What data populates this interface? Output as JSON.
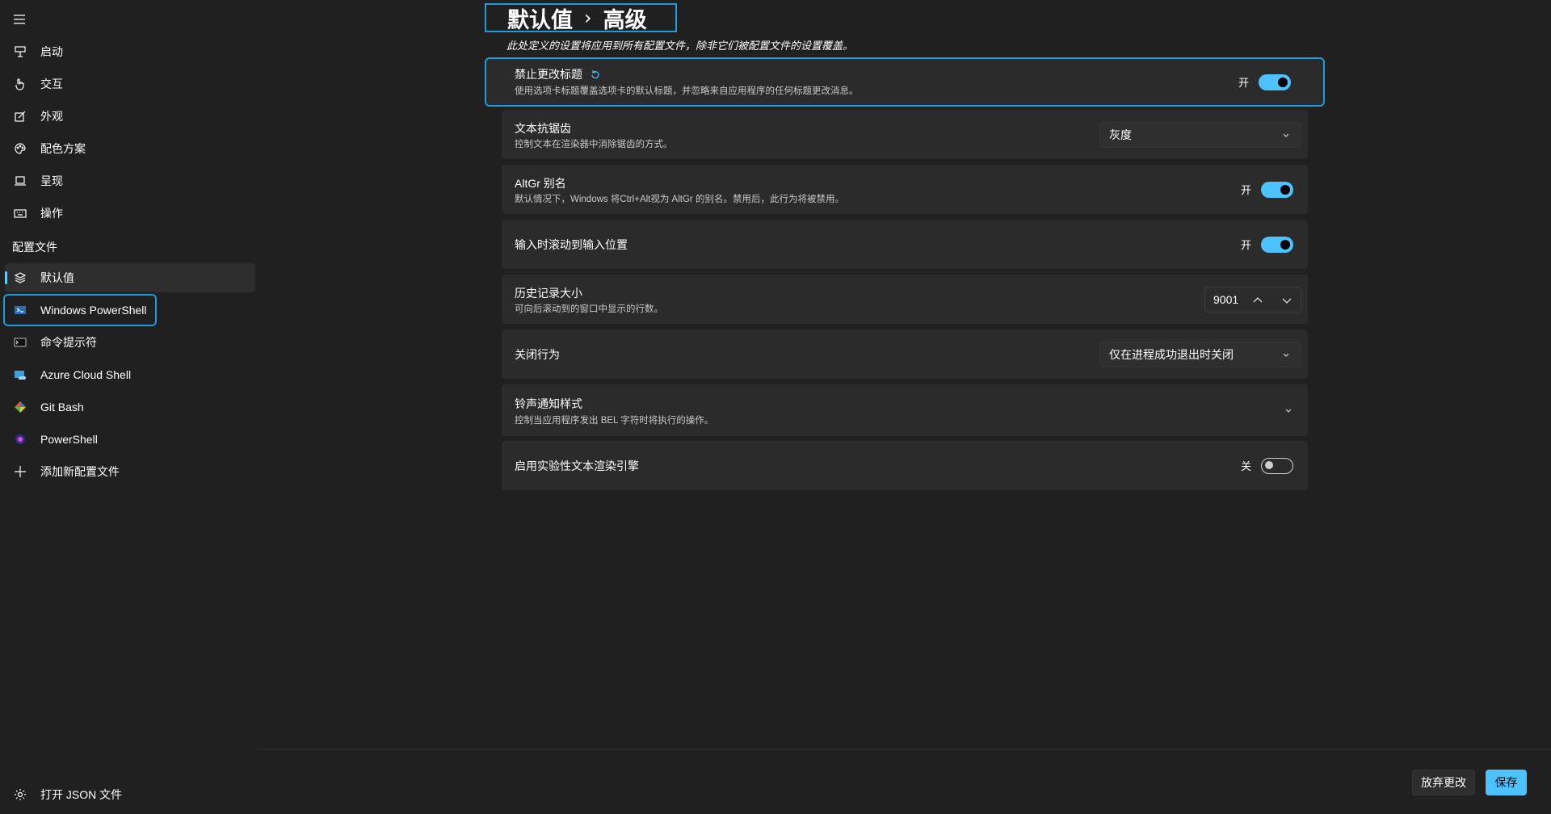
{
  "sidebar": {
    "items": [
      {
        "label": "启动",
        "icon": "startup-icon"
      },
      {
        "label": "交互",
        "icon": "interaction-icon"
      },
      {
        "label": "外观",
        "icon": "appearance-icon"
      },
      {
        "label": "配色方案",
        "icon": "palette-icon"
      },
      {
        "label": "呈现",
        "icon": "rendering-icon"
      },
      {
        "label": "操作",
        "icon": "keyboard-icon"
      }
    ],
    "profiles_header": "配置文件",
    "profiles": [
      {
        "label": "默认值",
        "icon": "layers-icon"
      },
      {
        "label": "Windows PowerShell",
        "icon": "powershell-icon"
      },
      {
        "label": "命令提示符",
        "icon": "cmd-icon"
      },
      {
        "label": "Azure Cloud Shell",
        "icon": "azure-icon"
      },
      {
        "label": "Git Bash",
        "icon": "git-icon"
      },
      {
        "label": "PowerShell",
        "icon": "pwsh-icon"
      }
    ],
    "add_profile": "添加新配置文件",
    "open_json": "打开 JSON 文件"
  },
  "header": {
    "crumb_parent": "默认值",
    "crumb_sep": "›",
    "crumb_current": "高级",
    "subtitle": "此处定义的设置将应用到所有配置文件，除非它们被配置文件的设置覆盖。"
  },
  "settings": {
    "suppress_title": {
      "title": "禁止更改标题",
      "desc": "使用选项卡标题覆盖选项卡的默认标题，并忽略来自应用程序的任何标题更改消息。",
      "state": "开"
    },
    "antialias": {
      "title": "文本抗锯齿",
      "desc": "控制文本在渲染器中消除锯齿的方式。",
      "value": "灰度"
    },
    "altgr": {
      "title": "AltGr 别名",
      "desc": "默认情况下，Windows 将Ctrl+Alt视为 AltGr 的别名。禁用后，此行为将被禁用。",
      "state": "开"
    },
    "scroll_input": {
      "title": "输入时滚动到输入位置",
      "state": "开"
    },
    "history": {
      "title": "历史记录大小",
      "desc": "可向后滚动到的窗口中显示的行数。",
      "value": "9001"
    },
    "close": {
      "title": "关闭行为",
      "value": "仅在进程成功退出时关闭"
    },
    "bell": {
      "title": "铃声通知样式",
      "desc": "控制当应用程序发出 BEL 字符时将执行的操作。"
    },
    "experimental": {
      "title": "启用实验性文本渲染引擎",
      "state": "关"
    }
  },
  "footer": {
    "discard": "放弃更改",
    "save": "保存"
  },
  "colors": {
    "accent": "#4cc2ff",
    "focus": "#1f9bde",
    "background": "#202020",
    "card": "#2b2b2b"
  }
}
